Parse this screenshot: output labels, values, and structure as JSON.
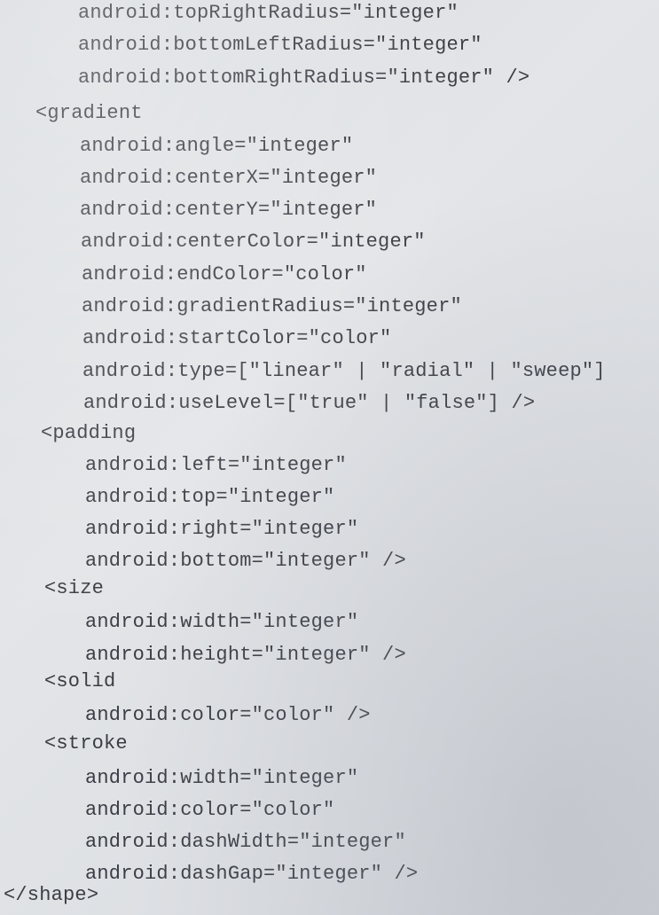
{
  "code_lines": [
    "android:topRightRadius=\"integer\"",
    "android:bottomLeftRadius=\"integer\"",
    "android:bottomRightRadius=\"integer\" />",
    "<gradient",
    "android:angle=\"integer\"",
    "android:centerX=\"integer\"",
    "android:centerY=\"integer\"",
    "android:centerColor=\"integer\"",
    "android:endColor=\"color\"",
    "android:gradientRadius=\"integer\"",
    "android:startColor=\"color\"",
    "android:type=[\"linear\" | \"radial\" | \"sweep\"]",
    "android:useLevel=[\"true\" | \"false\"] />",
    "<padding",
    "android:left=\"integer\"",
    "android:top=\"integer\"",
    "android:right=\"integer\"",
    "android:bottom=\"integer\" />",
    "<size",
    "android:width=\"integer\"",
    "android:height=\"integer\" />",
    "<solid",
    "android:color=\"color\" />",
    "<stroke",
    "android:width=\"integer\"",
    "android:color=\"color\"",
    "android:dashWidth=\"integer\"",
    "android:dashGap=\"integer\" />",
    "</shape>"
  ]
}
